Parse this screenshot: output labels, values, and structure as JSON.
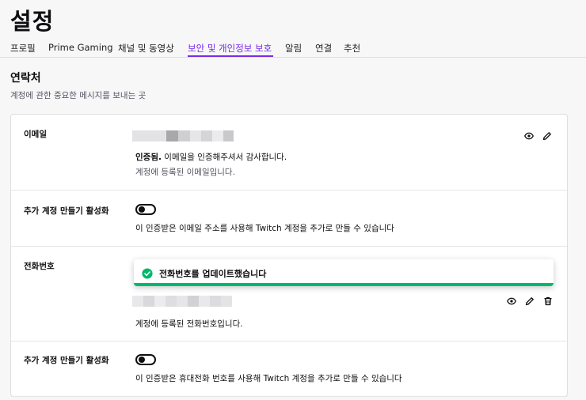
{
  "page_title": "설정",
  "tabs": [
    {
      "label": "프로필",
      "active": false
    },
    {
      "label": "Prime Gaming",
      "active": false
    },
    {
      "label": "채널 및 동영상",
      "active": false
    },
    {
      "label": "보안 및 개인정보 보호",
      "active": true
    },
    {
      "label": "알림",
      "active": false
    },
    {
      "label": "연결",
      "active": false
    },
    {
      "label": "추천",
      "active": false
    }
  ],
  "contact": {
    "title": "연락처",
    "description": "계정에 관한 중요한 메시지를 보내는 곳"
  },
  "email": {
    "label": "이메일",
    "verified_bold": "인증됨.",
    "verified_text": " 이메일을 인증해주셔서 감사합니다.",
    "helper": "계정에 등록된 이메일입니다."
  },
  "email_toggle": {
    "label": "추가 계정 만들기 활성화",
    "description": "이 인증받은 이메일 주소를 사용해 Twitch 계정을 추가로 만들 수 있습니다",
    "enabled": false
  },
  "phone": {
    "label": "전화번호",
    "helper": "계정에 등록된 전화번호입니다."
  },
  "phone_toggle": {
    "label": "추가 계정 만들기 활성화",
    "description": "이 인증받은 휴대전화 번호를 사용해 Twitch 계정을 추가로 만들 수 있습니다",
    "enabled": false
  },
  "toast": {
    "message": "전화번호를 업데이트했습니다",
    "status_color": "#00b76b"
  },
  "colors": {
    "accent": "#772ce8",
    "success": "#00b76b"
  },
  "icons": {
    "reveal": "eye-icon",
    "edit": "pencil-icon",
    "delete": "trash-icon",
    "success": "check-circle-icon"
  }
}
